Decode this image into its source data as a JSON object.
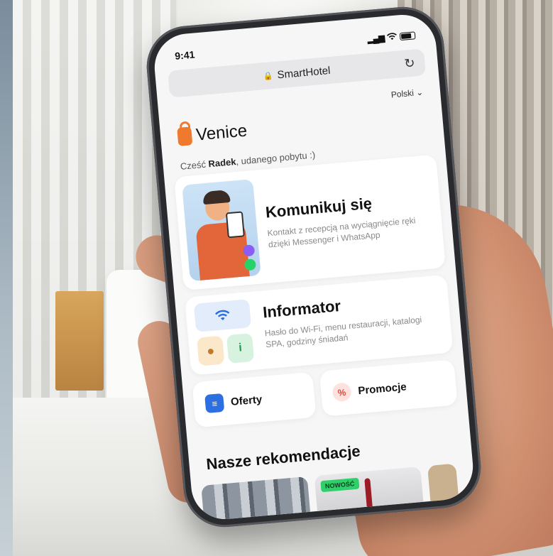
{
  "status": {
    "time": "9:41"
  },
  "browser": {
    "url_label": "SmartHotel",
    "lock_icon": "lock-icon",
    "reload_icon": "reload-icon"
  },
  "header": {
    "language": "Polski",
    "language_chevron": "⌄",
    "brand_name": "Venice"
  },
  "greeting": {
    "prefix": "Cześć ",
    "name": "Radek",
    "suffix": ", udanego pobytu :)"
  },
  "cards": {
    "komunikuj": {
      "title": "Komunikuj się",
      "description": "Kontakt z recepcją na wyciągnięcie ręki dzięki Messenger i WhatsApp"
    },
    "informator": {
      "title": "Informator",
      "description": "Hasło do Wi-Fi, menu restauracji, katalogi SPA, godziny śniadań"
    },
    "oferty": {
      "label": "Oferty"
    },
    "promocje": {
      "label": "Promocje"
    }
  },
  "recommendations": {
    "title": "Nasze rekomendacje",
    "items": [
      {
        "badge": ""
      },
      {
        "badge": "NOWOŚĆ"
      }
    ]
  },
  "colors": {
    "brand_orange": "#ef7a2e",
    "accent_blue": "#2d6fe0",
    "promo_red": "#e4483a",
    "new_badge_green": "#2fd06a"
  }
}
